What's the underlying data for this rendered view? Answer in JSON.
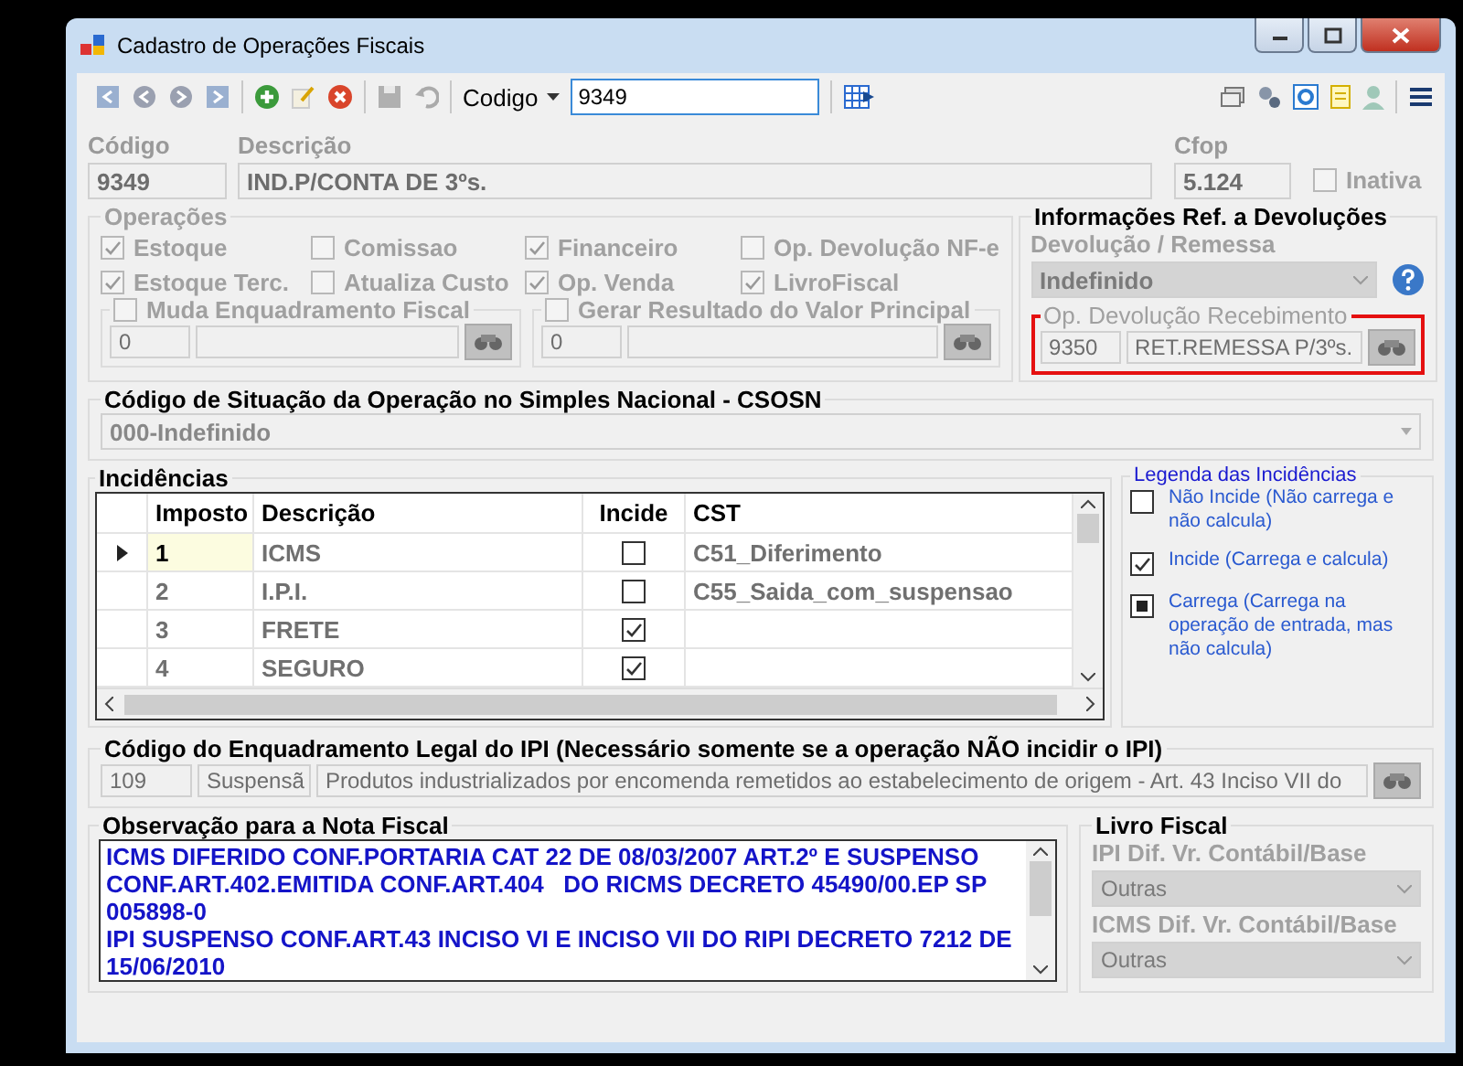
{
  "window": {
    "title": "Cadastro de Operações Fiscais"
  },
  "toolbar": {
    "search_label": "Codigo",
    "search_value": "9349"
  },
  "header": {
    "codigo_label": "Código",
    "codigo": "9349",
    "descricao_label": "Descrição",
    "descricao": "IND.P/CONTA DE 3ºs.",
    "cfop_label": "Cfop",
    "cfop": "5.124",
    "inativa": {
      "label": "Inativa",
      "checked": false
    }
  },
  "operacoes": {
    "title": "Operações",
    "options": [
      {
        "label": "Estoque",
        "checked": true
      },
      {
        "label": "Comissao",
        "checked": false
      },
      {
        "label": "Financeiro",
        "checked": true
      },
      {
        "label": "Op.  Devolução NF-e",
        "checked": false
      },
      {
        "label": "Estoque Terc.",
        "checked": true
      },
      {
        "label": "Atualiza Custo",
        "checked": false
      },
      {
        "label": "Op. Venda",
        "checked": true
      },
      {
        "label": "LivroFiscal",
        "checked": true
      }
    ],
    "subgroups": [
      {
        "label": "Muda Enquadramento Fiscal",
        "checked": false,
        "code": "0"
      },
      {
        "label": "Gerar Resultado do Valor Principal",
        "checked": false,
        "code": "0"
      }
    ]
  },
  "devolucoes": {
    "title": "Informações Ref. a Devoluções",
    "tipo_label": "Devolução / Remessa",
    "tipo": "Indefinido",
    "recebimento": {
      "title": "Op. Devolução Recebimento",
      "code": "9350",
      "description": "RET.REMESSA P/3ºs.",
      "highlighted": true
    }
  },
  "csosn": {
    "title": "Código de Situação da Operação no Simples Nacional - CSOSN",
    "value": "000-Indefinido"
  },
  "incidencias": {
    "title": "Incidências",
    "columns": [
      "Imposto",
      "Descrição",
      "Incide",
      "CST"
    ],
    "rows": [
      {
        "imposto": "1",
        "descricao": "ICMS",
        "incide": false,
        "cst": "C51_Diferimento",
        "selected": true
      },
      {
        "imposto": "2",
        "descricao": "I.P.I.",
        "incide": false,
        "cst": "C55_Saida_com_suspensao",
        "selected": false
      },
      {
        "imposto": "3",
        "descricao": "FRETE",
        "incide": true,
        "cst": "",
        "selected": false
      },
      {
        "imposto": "4",
        "descricao": "SEGURO",
        "incide": true,
        "cst": "",
        "selected": false
      }
    ]
  },
  "legenda": {
    "title": "Legenda das Incidências",
    "items": [
      {
        "kind": "empty",
        "label": "Não Incide (Não carrega e não calcula)"
      },
      {
        "kind": "check",
        "label": "Incide (Carrega e calcula)"
      },
      {
        "kind": "fill",
        "label": "Carrega (Carrega na operação de entrada, mas não calcula)"
      }
    ]
  },
  "ipi": {
    "title": "Código do Enquadramento Legal do IPI (Necessário somente se a operação NÃO incidir o IPI)",
    "code": "109",
    "type": "Suspensã",
    "description": "Produtos industrializados por encomenda remetidos ao estabelecimento de origem - Art. 43 Inciso VII do"
  },
  "observacao": {
    "title": "Observação para a Nota Fiscal",
    "text": "ICMS DIFERIDO CONF.PORTARIA CAT 22 DE 08/03/2007 ART.2º E SUSPENSO CONF.ART.402.EMITIDA CONF.ART.404   DO RICMS DECRETO 45490/00.EP SP 005898-0\nIPI SUSPENSO CONF.ART.43 INCISO VI E INCISO VII DO RIPI DECRETO 7212 DE 15/06/2010"
  },
  "livro": {
    "title": "Livro Fiscal",
    "fields": [
      {
        "label": "IPI Dif. Vr. Contábil/Base",
        "value": "Outras"
      },
      {
        "label": "ICMS Dif. Vr. Contábil/Base",
        "value": "Outras"
      }
    ]
  }
}
